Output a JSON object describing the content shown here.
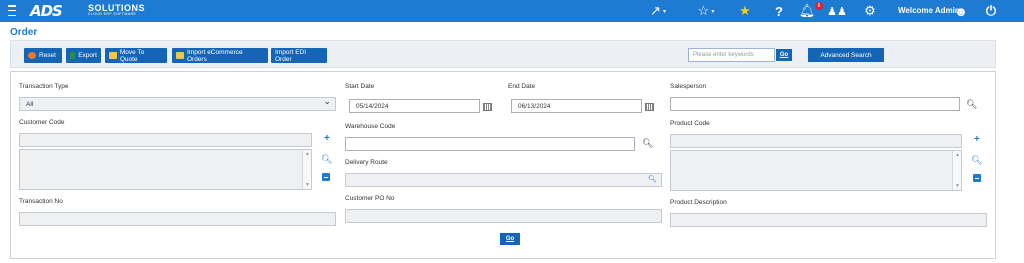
{
  "header": {
    "logo_text": "ADS",
    "logo_sub": "SOLUTIONS",
    "logo_tag": "CLOUD ERP SOFTWARE",
    "notification_count": "6",
    "welcome": "Welcome Admin",
    "icons": [
      "menu-icon",
      "share-icon",
      "star-outline-icon",
      "star-filled-icon",
      "help-icon",
      "bell-icon",
      "users-icon",
      "gear-icon",
      "user-circle-icon",
      "power-icon"
    ],
    "accent": "#1f7bd1",
    "star_color": "#f4d20b"
  },
  "page": {
    "title": "Order"
  },
  "toolbar": {
    "reset": "Reset",
    "export": "Export",
    "move_to_quote": "Move To Quote",
    "import_ecommerce": "Import eCommerce Orders",
    "import_edi": "Import EDI Order",
    "search_placeholder": "Please enter keywords",
    "go": "Go",
    "advanced_search": "Advanced Search"
  },
  "form": {
    "transaction_type_label": "Transaction Type",
    "transaction_type_value": "All",
    "start_date_label": "Start Date",
    "start_date_value": "05/14/2024",
    "end_date_label": "End Date",
    "end_date_value": "06/13/2024",
    "salesperson_label": "Salesperson",
    "customer_code_label": "Customer Code",
    "warehouse_code_label": "Warehouse Code",
    "product_code_label": "Product Code",
    "delivery_route_label": "Delivery Route",
    "transaction_no_label": "Transaction No",
    "customer_po_label": "Customer PO No",
    "product_description_label": "Product Description",
    "go": "Go"
  }
}
